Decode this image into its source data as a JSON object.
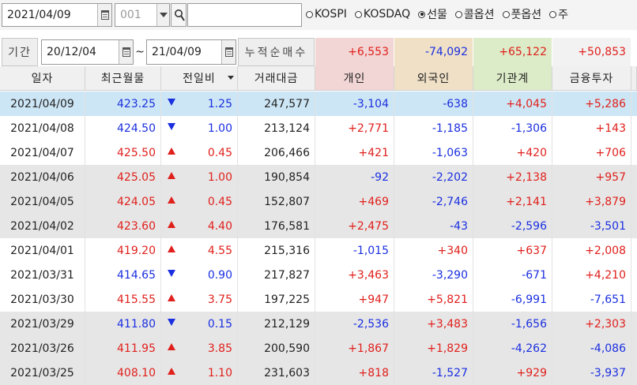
{
  "toolbar": {
    "date": "2021/04/09",
    "code_placeholder": "001",
    "search_value": "",
    "radios": [
      {
        "label": "KOSPI",
        "selected": false
      },
      {
        "label": "KOSDAQ",
        "selected": false
      },
      {
        "label": "선물",
        "selected": true
      },
      {
        "label": "콜옵션",
        "selected": false
      },
      {
        "label": "풋옵션",
        "selected": false
      },
      {
        "label": "주",
        "selected": false
      }
    ]
  },
  "period": {
    "label": "기간",
    "start": "20/12/04",
    "tilde": "~",
    "end": "21/04/09",
    "summary_label": "누적순매수",
    "totals": [
      "+6,553",
      "-74,092",
      "+65,122",
      "+50,853"
    ]
  },
  "table": {
    "headers": [
      "일자",
      "최근월물",
      "전일비",
      "거래대금",
      "개인",
      "외국인",
      "기관계",
      "금융투자"
    ],
    "rows": [
      {
        "date": "2021/04/09",
        "price": "423.25",
        "dir": "down",
        "change": "1.25",
        "volume": "247,577",
        "indiv": "-3,104",
        "foreign": "-638",
        "inst": "+4,045",
        "fin": "+5,286"
      },
      {
        "date": "2021/04/08",
        "price": "424.50",
        "dir": "down",
        "change": "1.00",
        "volume": "213,124",
        "indiv": "+2,771",
        "foreign": "-1,185",
        "inst": "-1,306",
        "fin": "+143"
      },
      {
        "date": "2021/04/07",
        "price": "425.50",
        "dir": "up",
        "change": "0.45",
        "volume": "206,466",
        "indiv": "+421",
        "foreign": "-1,063",
        "inst": "+420",
        "fin": "+706"
      },
      {
        "date": "2021/04/06",
        "price": "425.05",
        "dir": "up",
        "change": "1.00",
        "volume": "190,854",
        "indiv": "-92",
        "foreign": "-2,202",
        "inst": "+2,138",
        "fin": "+957"
      },
      {
        "date": "2021/04/05",
        "price": "424.05",
        "dir": "up",
        "change": "0.45",
        "volume": "152,807",
        "indiv": "+469",
        "foreign": "-2,746",
        "inst": "+2,141",
        "fin": "+3,879"
      },
      {
        "date": "2021/04/02",
        "price": "423.60",
        "dir": "up",
        "change": "4.40",
        "volume": "176,581",
        "indiv": "+2,475",
        "foreign": "-43",
        "inst": "-2,596",
        "fin": "-3,501"
      },
      {
        "date": "2021/04/01",
        "price": "419.20",
        "dir": "up",
        "change": "4.55",
        "volume": "215,316",
        "indiv": "-1,015",
        "foreign": "+340",
        "inst": "+637",
        "fin": "+2,008"
      },
      {
        "date": "2021/03/31",
        "price": "414.65",
        "dir": "down",
        "change": "0.90",
        "volume": "217,827",
        "indiv": "+3,463",
        "foreign": "-3,290",
        "inst": "-671",
        "fin": "+4,210"
      },
      {
        "date": "2021/03/30",
        "price": "415.55",
        "dir": "up",
        "change": "3.75",
        "volume": "197,225",
        "indiv": "+947",
        "foreign": "+5,821",
        "inst": "-6,991",
        "fin": "-7,651"
      },
      {
        "date": "2021/03/29",
        "price": "411.80",
        "dir": "down",
        "change": "0.15",
        "volume": "212,129",
        "indiv": "-2,536",
        "foreign": "+3,483",
        "inst": "-1,656",
        "fin": "+2,303"
      },
      {
        "date": "2021/03/26",
        "price": "411.95",
        "dir": "up",
        "change": "3.85",
        "volume": "200,590",
        "indiv": "+1,867",
        "foreign": "+1,829",
        "inst": "-4,262",
        "fin": "-4,086"
      },
      {
        "date": "2021/03/25",
        "price": "408.10",
        "dir": "up",
        "change": "1.10",
        "volume": "231,603",
        "indiv": "+818",
        "foreign": "-1,527",
        "inst": "+929",
        "fin": "-3,937"
      }
    ]
  },
  "colors": {
    "up": "#e0201c",
    "down": "#1a2fe0",
    "selected_row": "#cde6f5",
    "shaded_row": "#e6e6e6",
    "individual_header": "#f2d5d5",
    "foreign_header": "#efe0c6",
    "institution_header": "#dcebc8"
  },
  "icons": {
    "date_calendar": "calendar-icon",
    "code_dropdown": "chevron-down-icon",
    "search": "search-icon",
    "sort": "sort-down-icon"
  }
}
